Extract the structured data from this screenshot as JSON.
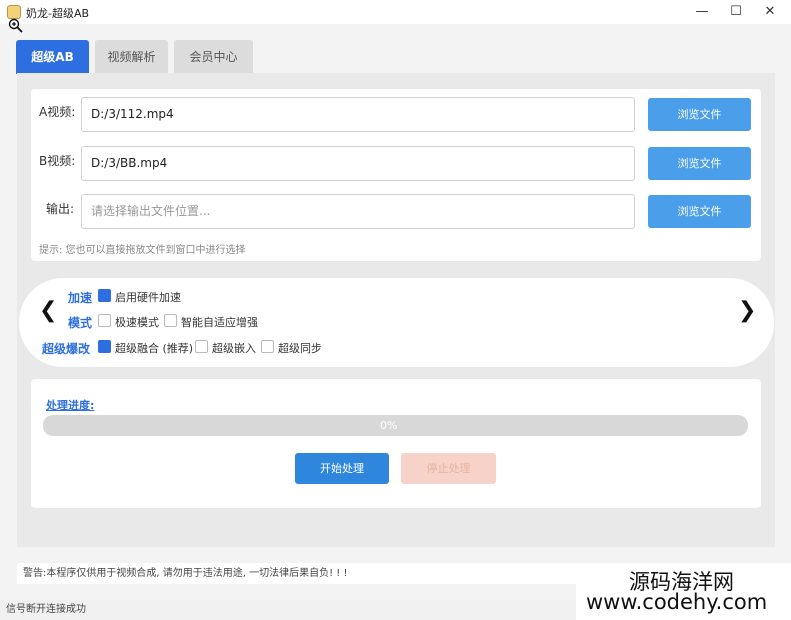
{
  "window": {
    "title": "奶龙-超级AB",
    "minimize": "—",
    "maximize": "☐",
    "close": "✕"
  },
  "tabs": [
    {
      "label": "超级AB",
      "active": true
    },
    {
      "label": "视频解析",
      "active": false
    },
    {
      "label": "会员中心",
      "active": false
    }
  ],
  "files": {
    "a_label": "A视频:",
    "a_value": "D:/3/112.mp4",
    "b_label": "B视频:",
    "b_value": "D:/3/BB.mp4",
    "out_label": "输出:",
    "out_placeholder": "请选择输出文件位置...",
    "browse_label": "浏览文件",
    "hint": "提示: 您也可以直接拖放文件到窗口中进行选择"
  },
  "options": {
    "row1_label": "加速",
    "row1_items": [
      {
        "label": "启用硬件加速",
        "checked": true
      }
    ],
    "row2_label": "模式",
    "row2_items": [
      {
        "label": "极速模式",
        "checked": false
      },
      {
        "label": "智能自适应增强",
        "checked": false
      }
    ],
    "row3_label": "超级爆改",
    "row3_items": [
      {
        "label": "超级融合 (推荐)",
        "checked": true
      },
      {
        "label": "超级嵌入",
        "checked": false
      },
      {
        "label": "超级同步",
        "checked": false
      }
    ],
    "prev_arrow": "❮",
    "next_arrow": "❯"
  },
  "progress": {
    "label": "处理进度:",
    "value_text": "0%",
    "value": 0,
    "start_label": "开始处理",
    "cancel_label": "停止处理"
  },
  "warning": "警告:本程序仅供用于视频合成, 请勿用于违法用途, 一切法律后果自负! ! !",
  "status": "信号断开连接成功",
  "watermark": {
    "line1": "源码海洋网",
    "line2": "www.codehy.com"
  },
  "colors": {
    "accent": "#2d6fe0",
    "browse": "#4a9eea",
    "cancel_disabled": "#f7d2c8"
  }
}
